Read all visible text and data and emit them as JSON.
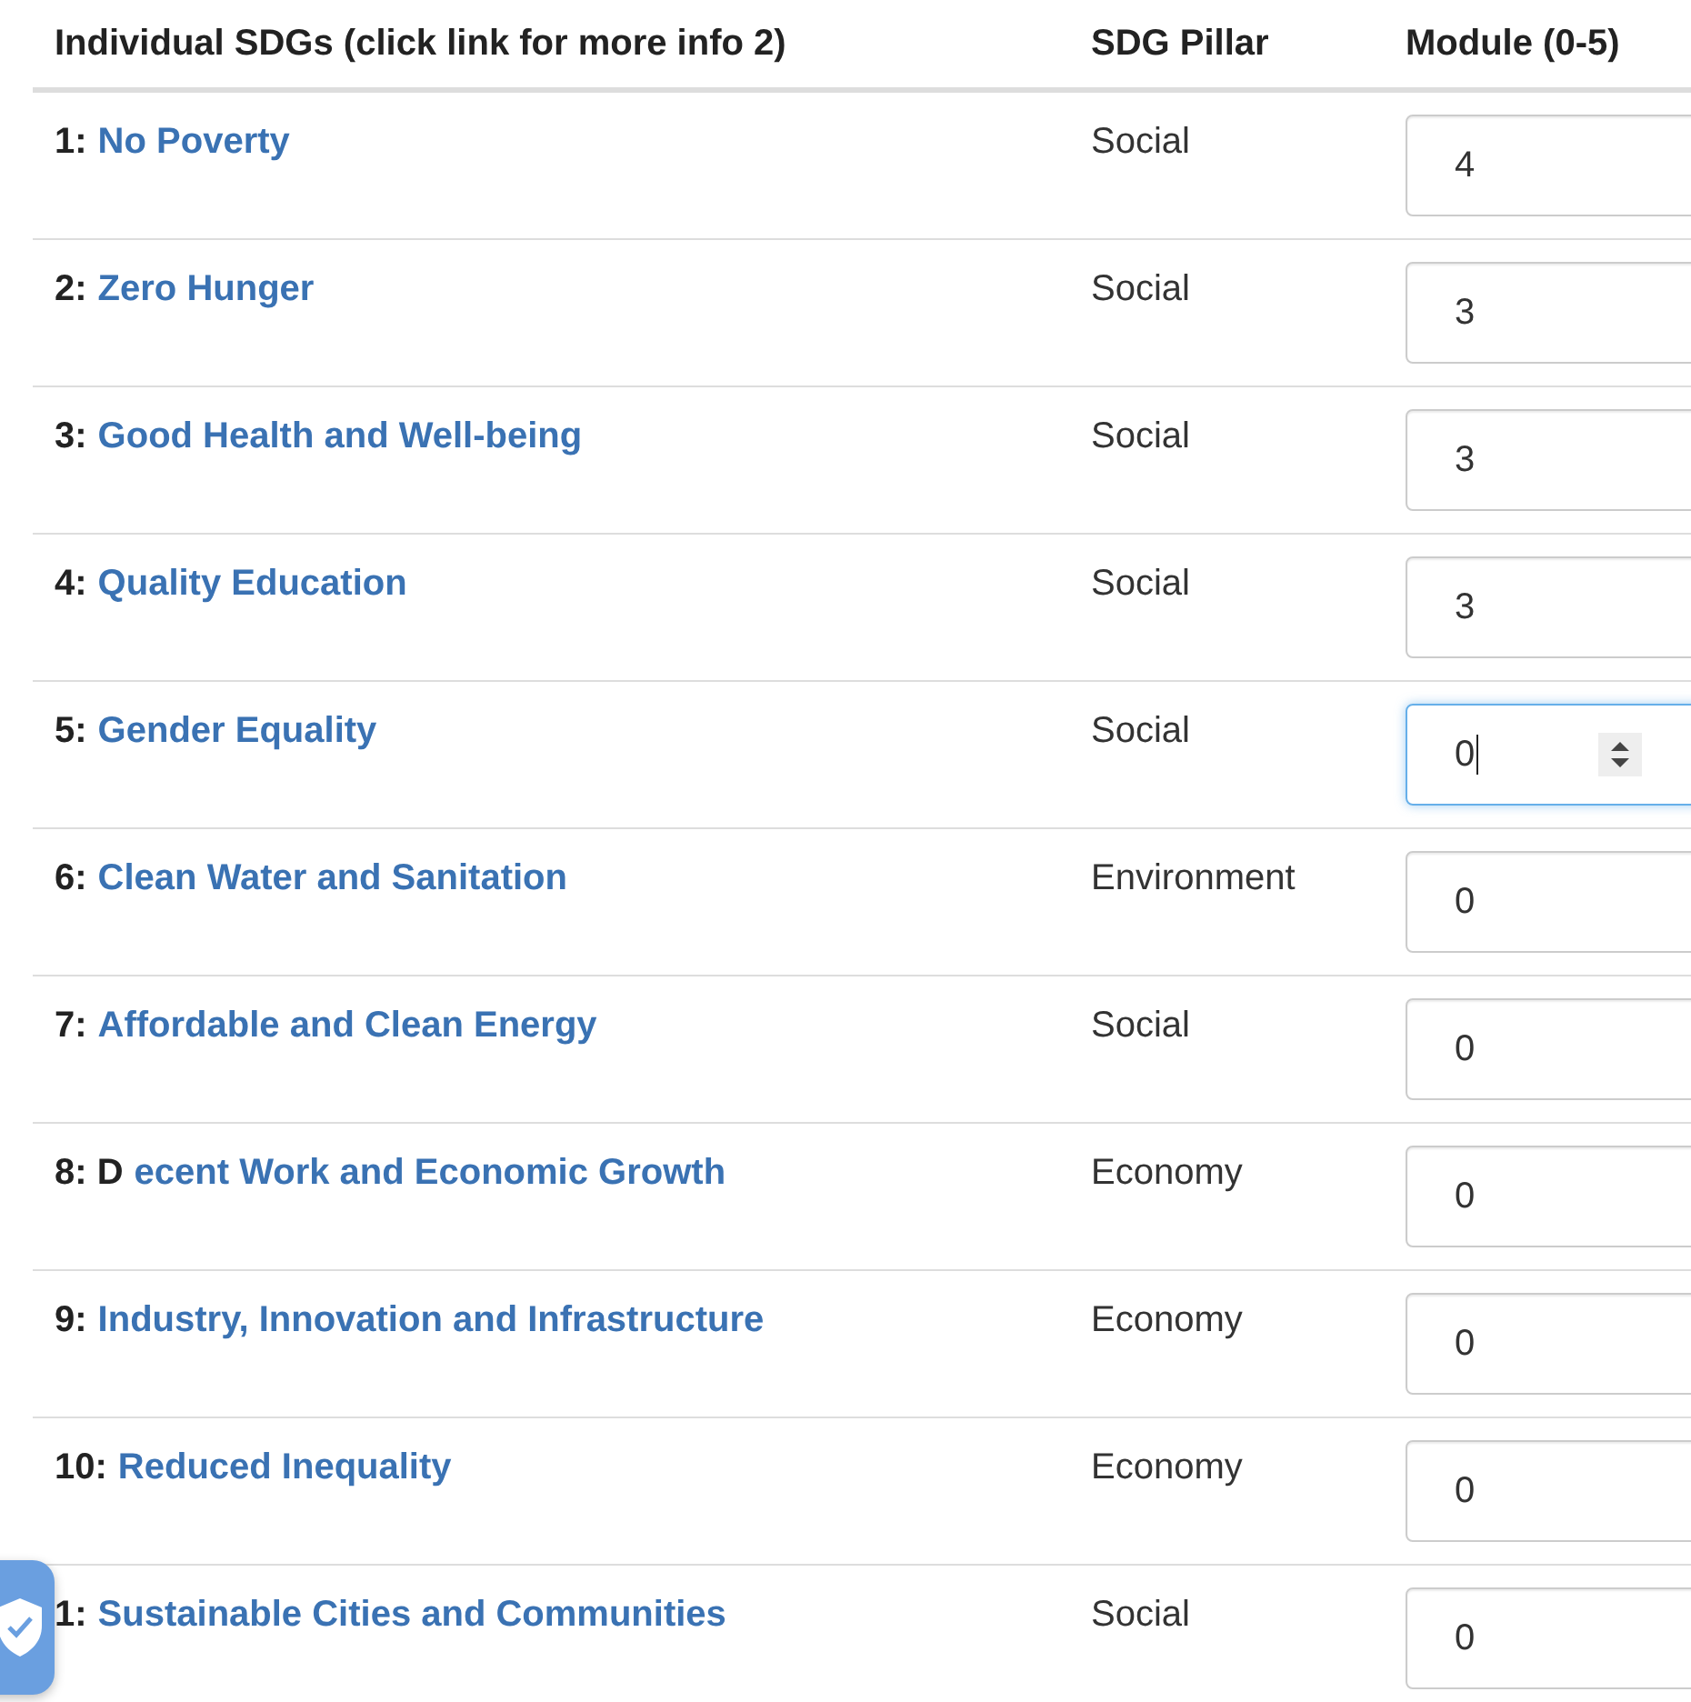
{
  "table": {
    "columns": [
      "Individual SDGs (click link for more info 2)",
      "SDG Pillar",
      "Module  (0-5)"
    ],
    "rows": [
      {
        "number": "1:",
        "link": "No Poverty",
        "pillar": "Social",
        "value": "4",
        "focused": false
      },
      {
        "number": "2:",
        "link": "Zero Hunger",
        "pillar": "Social",
        "value": "3",
        "focused": false
      },
      {
        "number": "3:",
        "link": "Good Health and Well-being",
        "pillar": "Social",
        "value": "3",
        "focused": false
      },
      {
        "number": "4:",
        "link": "Quality Education",
        "pillar": "Social",
        "value": "3",
        "focused": false
      },
      {
        "number": "5:",
        "link": "Gender Equality",
        "pillar": "Social",
        "value": "0",
        "focused": true
      },
      {
        "number": "6:",
        "link": "Clean Water and Sanitation",
        "pillar": "Environment",
        "value": "0",
        "focused": false
      },
      {
        "number": "7:",
        "link": "Affordable and Clean Energy",
        "pillar": "Social",
        "value": "0",
        "focused": false
      },
      {
        "number": "8: D",
        "link": "ecent Work and Economic Growth",
        "pillar": "Economy",
        "value": "0",
        "focused": false
      },
      {
        "number": "9:",
        "link": "Industry, Innovation and Infrastructure",
        "pillar": "Economy",
        "value": "0",
        "focused": false
      },
      {
        "number": "10:",
        "link": "Reduced Inequality",
        "pillar": "Economy",
        "value": "0",
        "focused": false
      },
      {
        "number": "1:",
        "link": "Sustainable Cities and Communities",
        "pillar": "Social",
        "value": "0",
        "focused": false
      }
    ]
  }
}
